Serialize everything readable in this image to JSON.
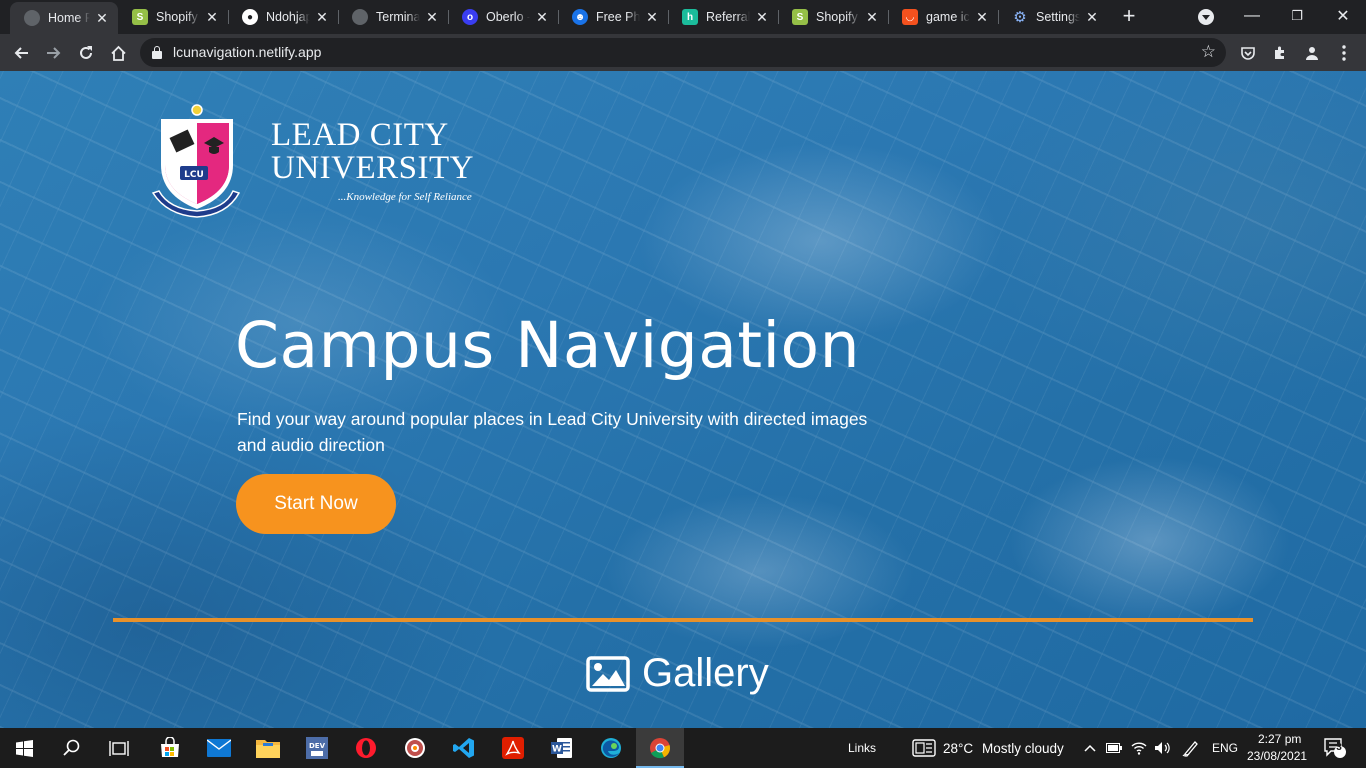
{
  "browser": {
    "tabs": [
      {
        "title": "Home Page",
        "favicon": "globe-icon",
        "active": true
      },
      {
        "title": "Shopify",
        "favicon": "shopify-icon"
      },
      {
        "title": "Ndohjapan",
        "favicon": "github-icon"
      },
      {
        "title": "Terminal",
        "favicon": "globe-icon"
      },
      {
        "title": "Oberlo - ",
        "favicon": "oberlo-icon"
      },
      {
        "title": "Free Photos",
        "favicon": "free-photos-icon"
      },
      {
        "title": "Referrals",
        "favicon": "referrals-icon"
      },
      {
        "title": "Shopify Partners",
        "favicon": "shopify-icon"
      },
      {
        "title": "game icons",
        "favicon": "game-icons-icon"
      },
      {
        "title": "Settings",
        "favicon": "settings-gear-icon"
      }
    ],
    "address": {
      "url": "lcunavigation.netlify.app"
    },
    "colors": {
      "tabstrip": "#202124",
      "toolbar": "#35363a",
      "omnibox": "#202124"
    }
  },
  "page": {
    "logo": {
      "name_line1": "LEAD CITY",
      "name_line2": "UNIVERSITY",
      "tagline": "...Knowledge for Self Reliance",
      "crest_text": "LCU"
    },
    "hero": {
      "title": "Campus Navigation",
      "subtitle": "Find your way around popular places in Lead City University with directed images and audio direction",
      "cta_label": "Start Now"
    },
    "gallery": {
      "label": "Gallery"
    },
    "colors": {
      "background": "#2a76b0",
      "accent": "#f7931e",
      "divider": "#e8912a",
      "crest_pink": "#e4287f"
    }
  },
  "taskbar": {
    "apps": [
      "start-icon",
      "search-icon",
      "task-view-icon",
      "store-icon",
      "mail-icon",
      "file-explorer-icon",
      "dev-icon",
      "opera-icon",
      "media-player-icon",
      "vscode-icon",
      "acrobat-icon",
      "word-icon",
      "edge-icon",
      "chrome-icon"
    ],
    "links_label": "Links",
    "weather": {
      "temp": "28°C",
      "condition": "Mostly cloudy"
    },
    "language": "ENG",
    "time": "2:27 pm",
    "date": "23/08/2021",
    "notifications": "3"
  }
}
